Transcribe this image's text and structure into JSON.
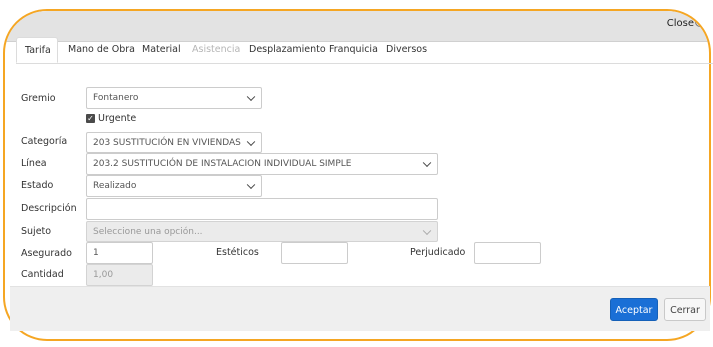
{
  "window": {
    "close_label": "Close"
  },
  "tabs": [
    {
      "label": "Tarifa",
      "active": true
    },
    {
      "label": "Mano de Obra"
    },
    {
      "label": "Material"
    },
    {
      "label": "Asistencia",
      "disabled": true
    },
    {
      "label": "Desplazamiento"
    },
    {
      "label": "Franquicia"
    },
    {
      "label": "Diversos"
    }
  ],
  "form": {
    "gremio": {
      "label": "Gremio",
      "value": "Fontanero"
    },
    "urgente": {
      "label": "Urgente",
      "checked": true
    },
    "categoria": {
      "label": "Categoría",
      "value": "203 SUSTITUCIÓN EN VIVIENDAS"
    },
    "linea": {
      "label": "Línea",
      "value": "203.2 SUSTITUCIÓN DE INSTALACION INDIVIDUAL SIMPLE"
    },
    "estado": {
      "label": "Estado",
      "value": "Realizado"
    },
    "descripcion": {
      "label": "Descripción",
      "value": ""
    },
    "sujeto": {
      "label": "Sujeto",
      "placeholder": "Seleccione una opción..."
    },
    "asegurado": {
      "label": "Asegurado",
      "value": "1"
    },
    "esteticos": {
      "label": "Estéticos",
      "value": ""
    },
    "perjudicado": {
      "label": "Perjudicado",
      "value": ""
    },
    "cantidad": {
      "label": "Cantidad",
      "value": "1,00"
    }
  },
  "footer": {
    "accept_label": "Aceptar",
    "cancel_label": "Cerrar"
  },
  "colors": {
    "accent": "#1a6fd6",
    "frame": "#f5a623",
    "titlebar": "#e3e3e3"
  }
}
